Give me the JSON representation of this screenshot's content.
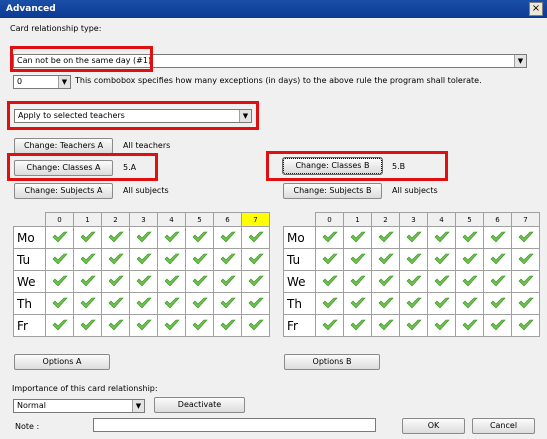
{
  "window": {
    "title": "Advanced",
    "close": "×"
  },
  "relationship": {
    "label": "Card relationship type:",
    "value": "Can not be on the same day (#1)"
  },
  "exceptions": {
    "value": "0",
    "help": "This combobox specifies how many exceptions (in days) to the above rule the program shall tolerate."
  },
  "apply": {
    "value": "Apply to selected teachers"
  },
  "groupA": {
    "teachers_btn": "Change: Teachers A",
    "teachers_val": "All teachers",
    "classes_btn": "Change: Classes A",
    "classes_val": "5.A",
    "subjects_btn": "Change: Subjects A",
    "subjects_val": "All subjects",
    "options_btn": "Options A"
  },
  "groupB": {
    "classes_btn": "Change: Classes B",
    "classes_val": "5.B",
    "subjects_btn": "Change: Subjects B",
    "subjects_val": "All subjects",
    "options_btn": "Options B"
  },
  "grid": {
    "periods": [
      "0",
      "1",
      "2",
      "3",
      "4",
      "5",
      "6",
      "7"
    ],
    "days": [
      "Mo",
      "Tu",
      "We",
      "Th",
      "Fr"
    ],
    "check_color": "#6cc24a",
    "highlight_color": "#ffff00"
  },
  "importance": {
    "label": "Importance of this card relationship:",
    "value": "Normal",
    "deactivate_btn": "Deactivate"
  },
  "note": {
    "label": "Note :",
    "value": ""
  },
  "footer": {
    "ok": "OK",
    "cancel": "Cancel"
  }
}
